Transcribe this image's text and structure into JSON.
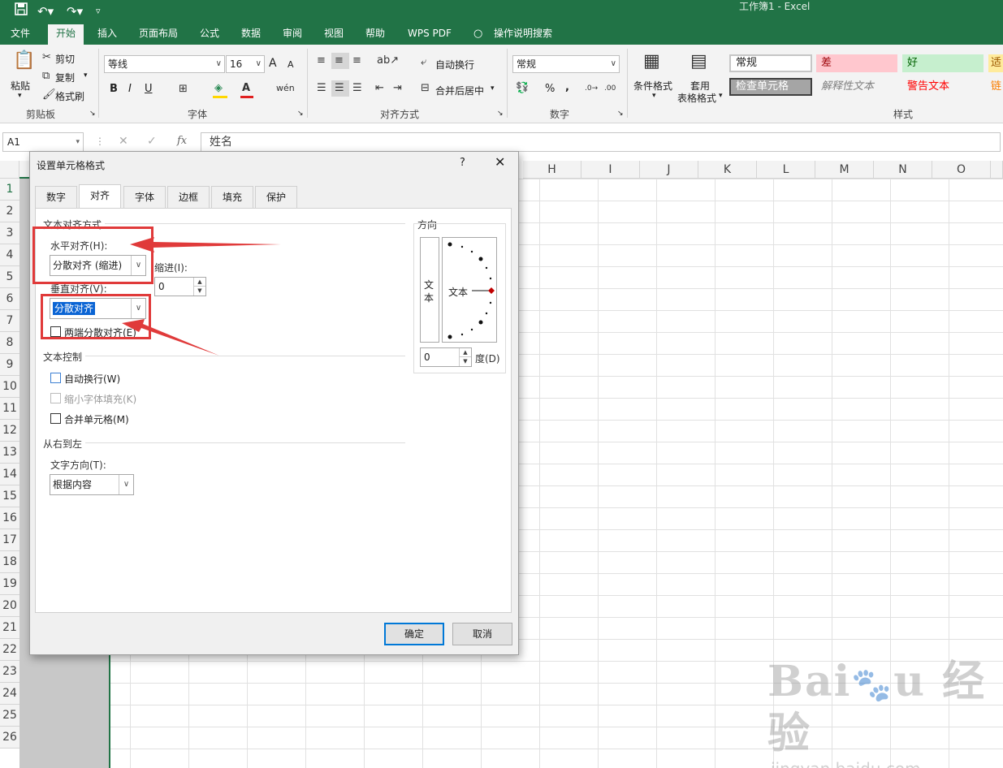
{
  "titlebar": {
    "doc_title": "工作簿1  -  Excel",
    "save_icon": "save-icon",
    "undo_icon": "undo-icon",
    "redo_icon": "redo-icon"
  },
  "menu": {
    "tabs": [
      "文件",
      "开始",
      "插入",
      "页面布局",
      "公式",
      "数据",
      "审阅",
      "视图",
      "帮助",
      "WPS PDF",
      "操作说明搜索"
    ],
    "active": "开始"
  },
  "ribbon": {
    "clipboard": {
      "paste": "粘贴",
      "cut": "剪切",
      "copy": "复制",
      "painter": "格式刷",
      "label": "剪贴板"
    },
    "font": {
      "name": "等线",
      "size": "16",
      "label": "字体",
      "bold": "B",
      "italic": "I",
      "underline": "U",
      "grow": "A",
      "shrink": "A"
    },
    "align": {
      "wrap": "自动换行",
      "merge": "合并后居中",
      "label": "对齐方式"
    },
    "number": {
      "format": "常规",
      "percent": "%",
      "comma": ",",
      "label": "数字"
    },
    "styles": {
      "cond_format": "条件格式",
      "table_format_1": "套用",
      "table_format_2": "表格格式",
      "cells": [
        "常规",
        "差",
        "好",
        "适",
        "检查单元格",
        "解释性文本",
        "警告文本",
        "链"
      ],
      "label": "样式"
    }
  },
  "formula_bar": {
    "name_box": "A1",
    "content": "姓名",
    "fx": "fx"
  },
  "grid": {
    "columns": [
      "H",
      "I",
      "J",
      "K",
      "L",
      "M",
      "N",
      "O"
    ],
    "rows": [
      "1",
      "2",
      "3",
      "4",
      "5",
      "6",
      "7",
      "8",
      "9",
      "10",
      "11",
      "12",
      "13",
      "14",
      "15",
      "16",
      "17",
      "18",
      "19",
      "20",
      "21",
      "22",
      "23",
      "24",
      "25",
      "26"
    ]
  },
  "dialog": {
    "title": "设置单元格格式",
    "help": "?",
    "close": "✕",
    "tabs": [
      "数字",
      "对齐",
      "字体",
      "边框",
      "填充",
      "保护"
    ],
    "active_tab": "对齐",
    "text_align_section": "文本对齐方式",
    "h_align_label": "水平对齐(H):",
    "h_align_value": "分散对齐 (缩进)",
    "indent_label": "缩进(I):",
    "indent_value": "0",
    "v_align_label": "垂直对齐(V):",
    "v_align_value": "分散对齐",
    "justify_distributed": "两端分散对齐(E)",
    "text_control_section": "文本控制",
    "wrap_text": "自动换行(W)",
    "shrink_fit": "缩小字体填充(K)",
    "merge_cells": "合并单元格(M)",
    "rtl_section": "从右到左",
    "text_direction_label": "文字方向(T):",
    "text_direction_value": "根据内容",
    "orientation_section": "方向",
    "vertical_text": "文本",
    "dial_text": "文本",
    "degree_value": "0",
    "degree_label": "度(D)",
    "ok": "确定",
    "cancel": "取消"
  },
  "colors": {
    "excel_green": "#217346",
    "highlight_red": "#e03a3a",
    "select_blue": "#0a64d4"
  }
}
